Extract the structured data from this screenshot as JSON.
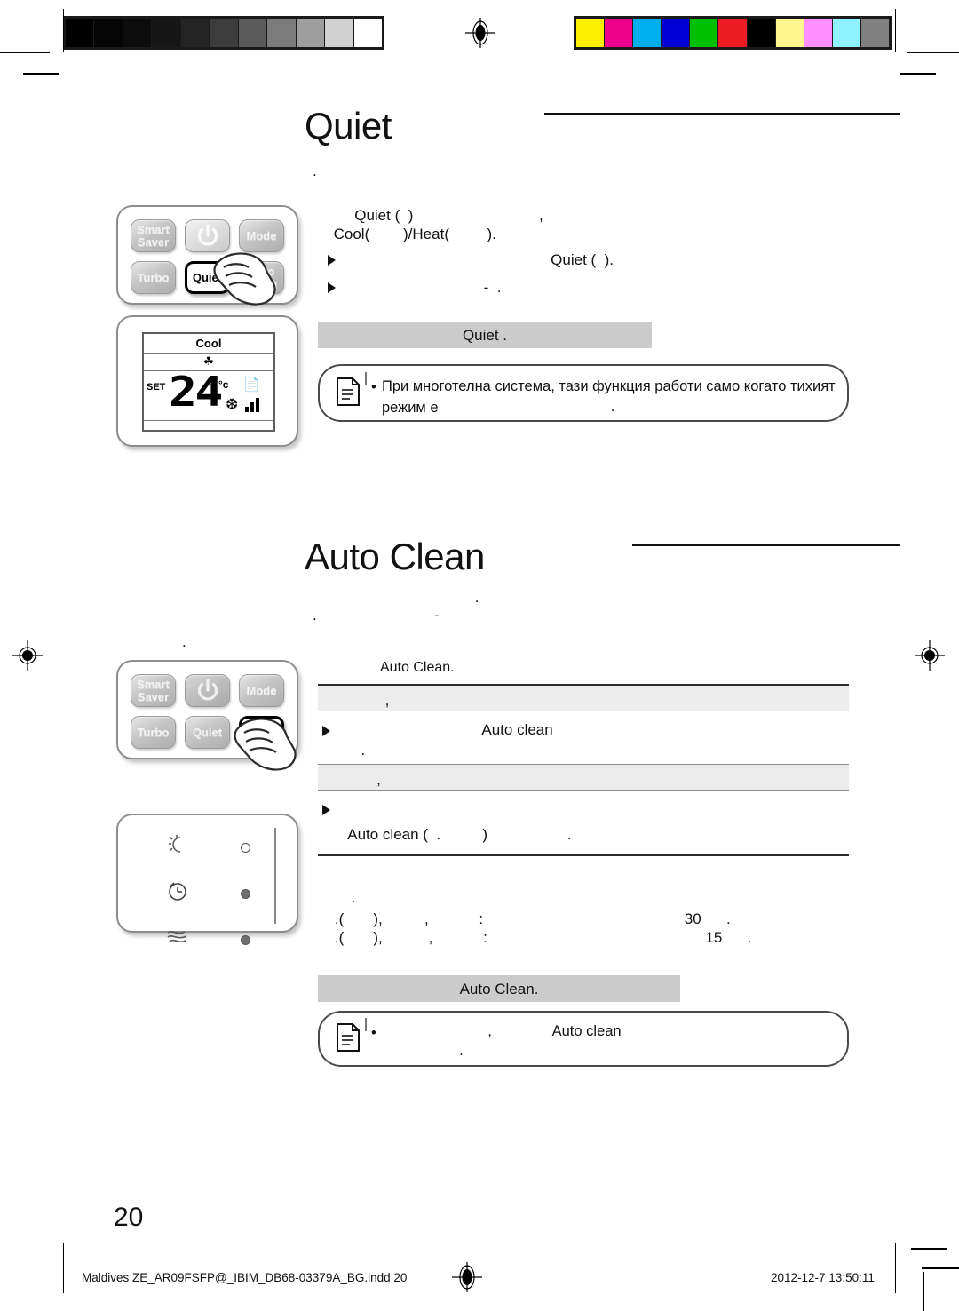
{
  "press_marks": {
    "grayscale_label": "grayscale-calibration-bar",
    "grayscale_swatches": [
      "#000000",
      "#050505",
      "#0c0c0c",
      "#161616",
      "#242424",
      "#3c3c3c",
      "#5a5a5a",
      "#7b7b7b",
      "#9e9e9e",
      "#d0d0d0",
      "#ffffff"
    ],
    "color_label": "color-calibration-bar",
    "color_swatches": [
      "#fff000",
      "#ec008c",
      "#00aeef",
      "#0000d4",
      "#00c000",
      "#ed1c24",
      "#000000",
      "#fff68f",
      "#ff8fff",
      "#8ff3ff",
      "#808080"
    ]
  },
  "sections": [
    {
      "id": "quiet",
      "title": "Quiet",
      "lead": ".",
      "body_lines": [
        "          Quiet (  )                              ,",
        "     Cool(        )/Heat(         )."
      ],
      "bullets": [
        "                                                  Quiet (  ).",
        "                                  -  ."
      ],
      "band_text": "Quiet .",
      "note": {
        "icon": "note-document-icon",
        "bullet": "•",
        "line1": "При многотелна система, тази функция работи само когато тихият режим е",
        "line2": "."
      },
      "remote": {
        "buttons": [
          {
            "label": "Smart\nSaver",
            "state": "dim"
          },
          {
            "label": "power-icon",
            "state": "active"
          },
          {
            "label": "Mode",
            "state": "dim"
          },
          {
            "label": "Turbo",
            "state": "dim"
          },
          {
            "label": "Quiet",
            "state": "highlight"
          },
          {
            "label": "Auto\nClean",
            "state": "dim"
          }
        ],
        "pressed_button": "Quiet"
      },
      "lcd": {
        "mode": "Cool",
        "set_label": "SET",
        "temperature": "24",
        "unit": "°c",
        "fan_icon": "fan-icon",
        "quiet_icon": "quiet-icon",
        "fan_speed_bars": 3
      }
    },
    {
      "id": "auto-clean",
      "title": "Auto Clean",
      "lead_lines": [
        " .",
        ".                            -"
      ],
      "sub_label": "Auto Clean.",
      "rows": [
        {
          "band": "                ,",
          "bullet_line": "                                   Auto clean",
          "extra": "      ."
        },
        {
          "band": "              ,",
          "bullet_line": "",
          "extra": "   Auto clean (  .          )                   ."
        }
      ],
      "spec_lines": [
        "        .",
        "    .(       ),          ,            :                                                30      .",
        "    .(       ),           ,            :                                                    15      ."
      ],
      "band_text": "Auto Clean.",
      "note": {
        "icon": "note-document-icon",
        "bullet": "•",
        "line1": "                          ,               Auto clean",
        "line2": "                   ."
      },
      "remote": {
        "buttons": [
          {
            "label": "Smart\nSaver",
            "state": "dim"
          },
          {
            "label": "power-icon",
            "state": "dim"
          },
          {
            "label": "Mode",
            "state": "dim"
          },
          {
            "label": "Turbo",
            "state": "dim"
          },
          {
            "label": "Quiet",
            "state": "dim"
          },
          {
            "label": "Auto\nClean",
            "state": "highlight"
          }
        ],
        "pressed_button": "Auto Clean"
      },
      "indicator_panel": {
        "rows": [
          {
            "icon": "sun-moon-icon",
            "led": "off"
          },
          {
            "icon": "timer-clock-icon",
            "led": "on"
          },
          {
            "icon": "airflow-waves-icon",
            "led": "on"
          }
        ]
      }
    }
  ],
  "page": {
    "number": "20",
    "footer_left": "Maldives ZE_AR09FSFP@_IBIM_DB68-03379A_BG.indd   20",
    "footer_right": "2012-12-7   13:50:11"
  }
}
